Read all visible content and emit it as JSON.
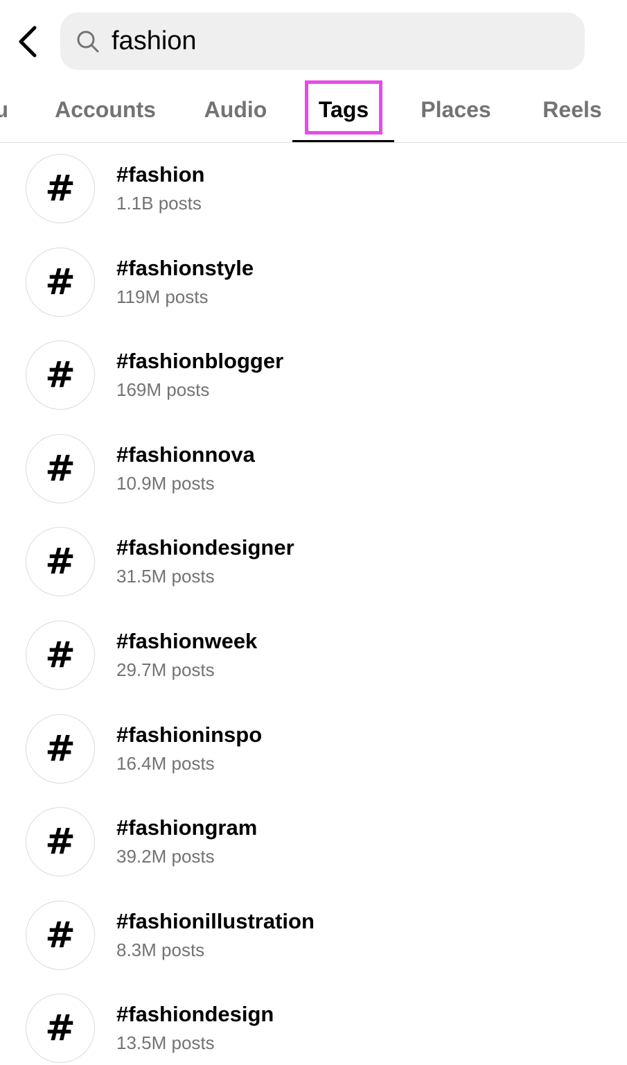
{
  "search": {
    "value": "fashion",
    "icon": "search-icon"
  },
  "header": {
    "back_icon": "chevron-left-icon"
  },
  "tabs": [
    {
      "label": "u",
      "active": false
    },
    {
      "label": "Accounts",
      "active": false
    },
    {
      "label": "Audio",
      "active": false
    },
    {
      "label": "Tags",
      "active": true
    },
    {
      "label": "Places",
      "active": false
    },
    {
      "label": "Reels",
      "active": false
    }
  ],
  "colors": {
    "highlight": "#e84be8",
    "secondary_text": "#737373",
    "search_bg": "#efefef"
  },
  "tag_symbol": "#",
  "tags": [
    {
      "name": "#fashion",
      "posts": "1.1B posts"
    },
    {
      "name": "#fashionstyle",
      "posts": "119M posts"
    },
    {
      "name": "#fashionblogger",
      "posts": "169M posts"
    },
    {
      "name": "#fashionnova",
      "posts": "10.9M posts"
    },
    {
      "name": "#fashiondesigner",
      "posts": "31.5M posts"
    },
    {
      "name": "#fashionweek",
      "posts": "29.7M posts"
    },
    {
      "name": "#fashioninspo",
      "posts": "16.4M posts"
    },
    {
      "name": "#fashiongram",
      "posts": "39.2M posts"
    },
    {
      "name": "#fashionillustration",
      "posts": "8.3M posts"
    },
    {
      "name": "#fashiondesign",
      "posts": "13.5M posts"
    }
  ]
}
